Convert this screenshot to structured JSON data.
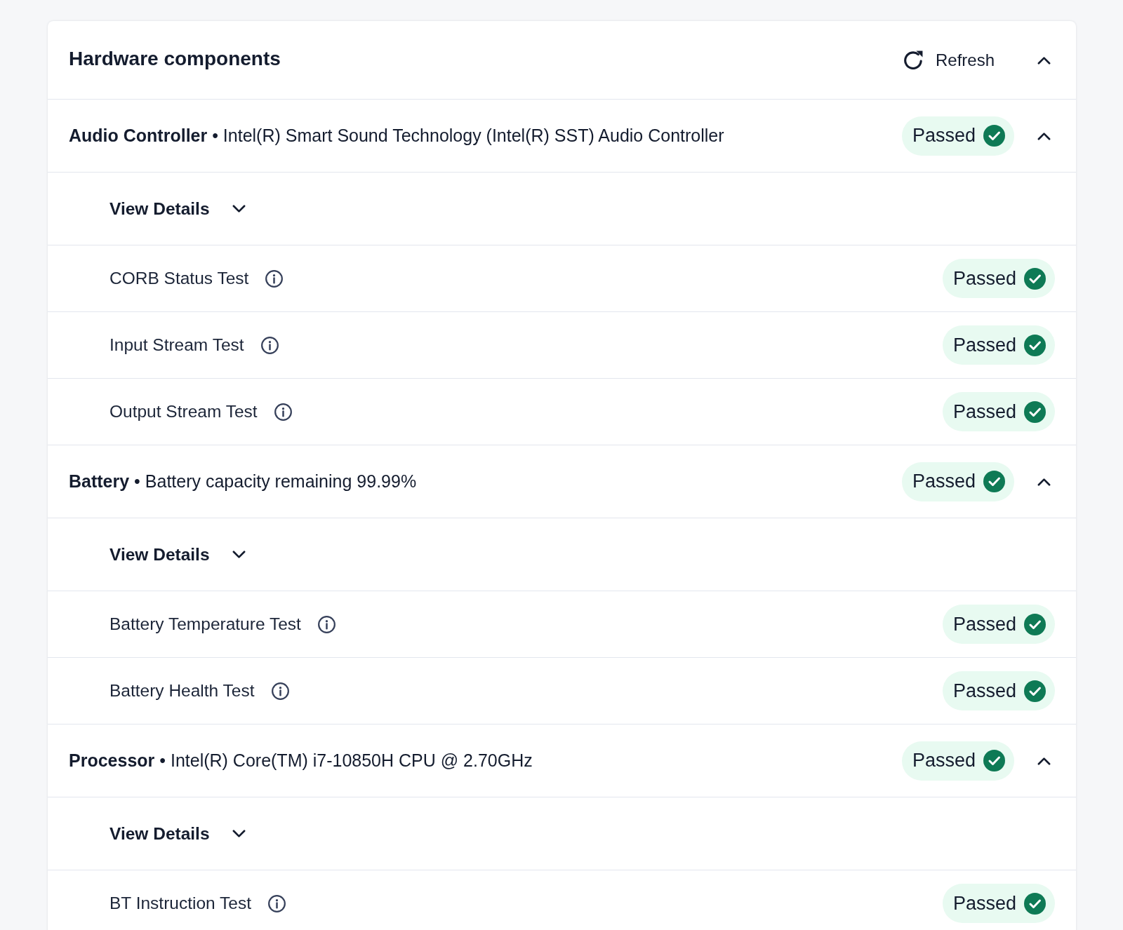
{
  "panel": {
    "title": "Hardware components",
    "refresh_label": "Refresh",
    "expanded": true
  },
  "components": [
    {
      "title": "**Audio Controller** • Intel(R) Smart Sound Technology (Intel(R) SST) Audio Controller",
      "passed": true,
      "status_label": "Passed",
      "expanded": true,
      "details": {
        "label": "View Details",
        "expanded": false
      },
      "tests": [
        {
          "name": "CORB Status Test",
          "passed": true,
          "status_label": "Passed"
        },
        {
          "name": "Input Stream Test",
          "passed": true,
          "status_label": "Passed"
        },
        {
          "name": "Output Stream Test",
          "passed": true,
          "status_label": "Passed"
        }
      ]
    },
    {
      "title": "**Battery** • Battery capacity remaining 99.99%",
      "passed": true,
      "status_label": "Passed",
      "expanded": true,
      "details": {
        "label": "View Details",
        "expanded": false
      },
      "tests": [
        {
          "name": "Battery Temperature Test",
          "passed": true,
          "status_label": "Passed"
        },
        {
          "name": "Battery Health Test",
          "passed": true,
          "status_label": "Passed"
        }
      ]
    },
    {
      "title": "**Processor** • Intel(R) Core(TM) i7-10850H CPU @ 2.70GHz",
      "passed": true,
      "status_label": "Passed",
      "expanded": true,
      "details": {
        "label": "View Details",
        "expanded": false
      },
      "tests": [
        {
          "name": "BT Instruction Test",
          "passed": true,
          "status_label": "Passed"
        }
      ]
    }
  ]
}
